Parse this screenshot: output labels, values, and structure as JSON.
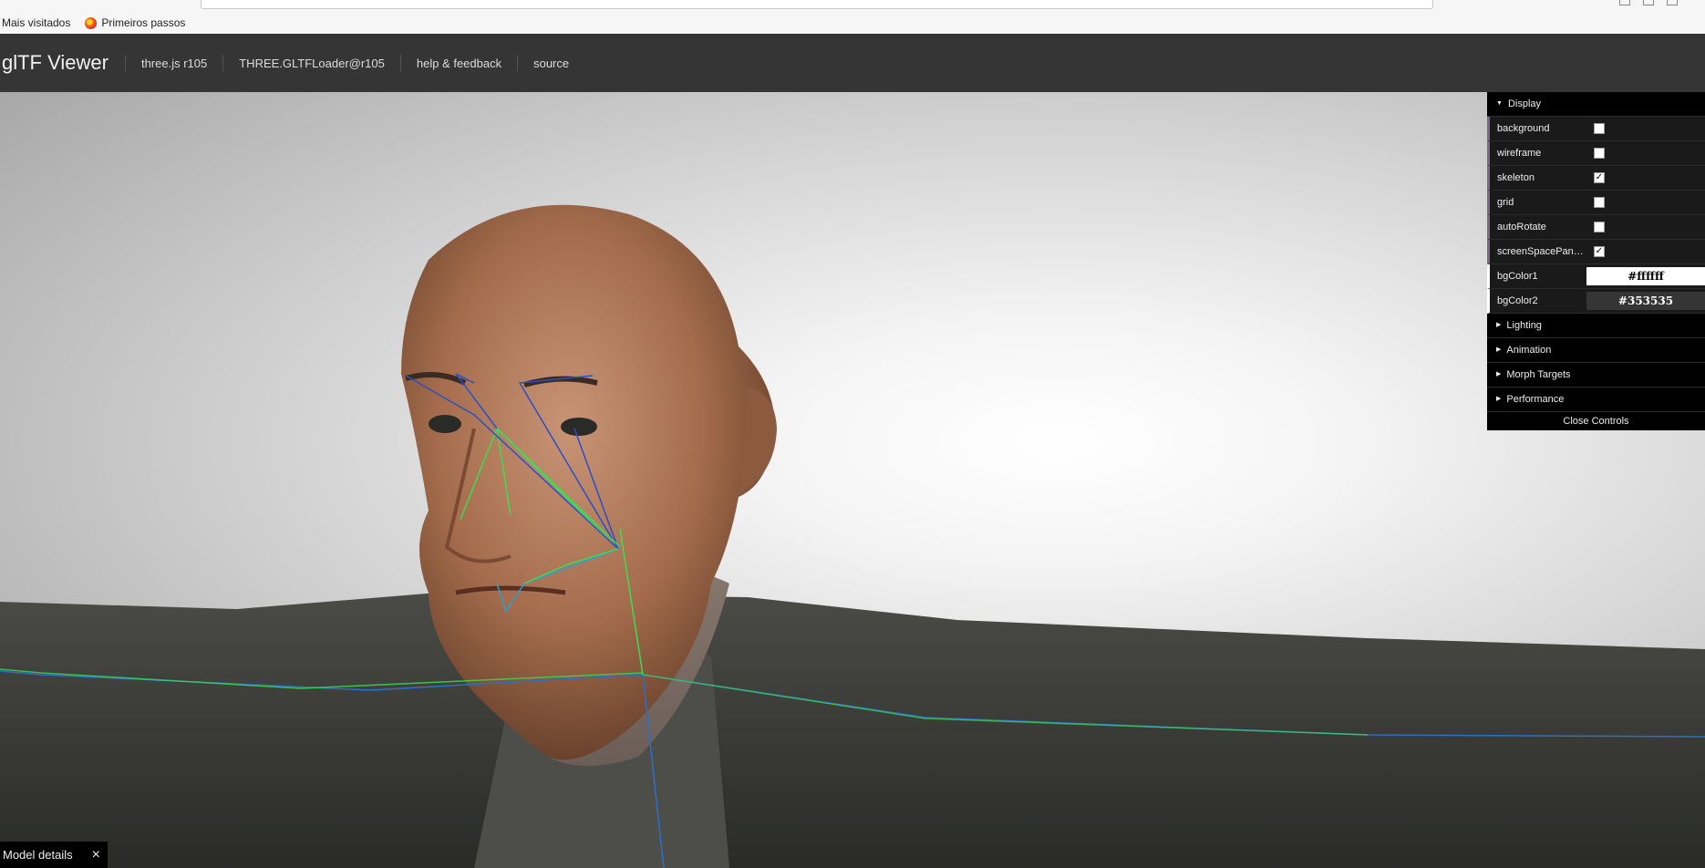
{
  "browser": {
    "bookmarks": [
      {
        "label": "Mais visitados",
        "icon": "bookmark-folder-icon"
      },
      {
        "label": "Primeiros passos",
        "icon": "firefox-icon"
      }
    ]
  },
  "header": {
    "title": "glTF Viewer",
    "links": [
      "three.js r105",
      "THREE.GLTFLoader@r105",
      "help & feedback",
      "source"
    ]
  },
  "gui": {
    "display": {
      "title": "Display",
      "expanded": true,
      "controls": [
        {
          "label": "background",
          "checked": false
        },
        {
          "label": "wireframe",
          "checked": false
        },
        {
          "label": "skeleton",
          "checked": true
        },
        {
          "label": "grid",
          "checked": false
        },
        {
          "label": "autoRotate",
          "checked": false
        },
        {
          "label": "screenSpacePan…",
          "checked": true
        }
      ],
      "colors": [
        {
          "label": "bgColor1",
          "value": "#ffffff",
          "text_color": "#000000"
        },
        {
          "label": "bgColor2",
          "value": "#353535",
          "text_color": "#ffffff"
        }
      ]
    },
    "folders": [
      "Lighting",
      "Animation",
      "Morph Targets",
      "Performance"
    ],
    "close_label": "Close Controls"
  },
  "model_details": {
    "label": "Model details",
    "close_icon": "×"
  },
  "colors": {
    "header_bg": "#353535",
    "gui_accent": "#806787",
    "bone_blue": "#2a4fc8",
    "bone_green": "#3ddc52",
    "skin": "#b07a58",
    "jacket": "#3c3d3a"
  }
}
